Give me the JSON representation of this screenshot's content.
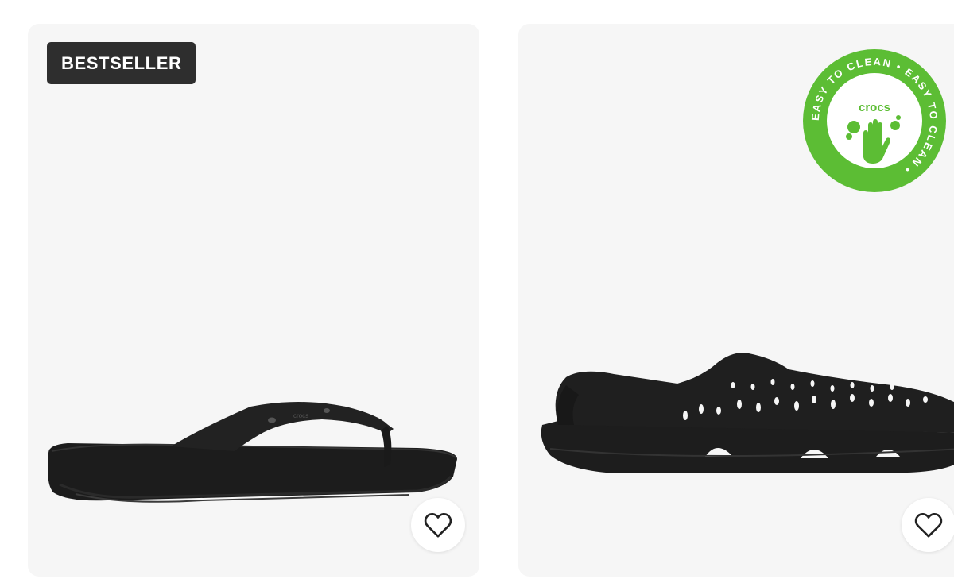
{
  "products": [
    {
      "badge": "BESTSELLER",
      "image": "black-flip-flop",
      "wishlist_icon": "heart-icon"
    },
    {
      "image": "black-perforated-sandal",
      "eco_badge": {
        "brand": "crocs",
        "ring_text": "EASY TO CLEAN • EASY TO CLEAN •",
        "color": "#5cbd34"
      },
      "wishlist_icon": "heart-icon"
    }
  ],
  "colors": {
    "card_bg": "#f6f6f6",
    "badge_bg": "#2e2e2e",
    "product": "#1f1f1f"
  }
}
